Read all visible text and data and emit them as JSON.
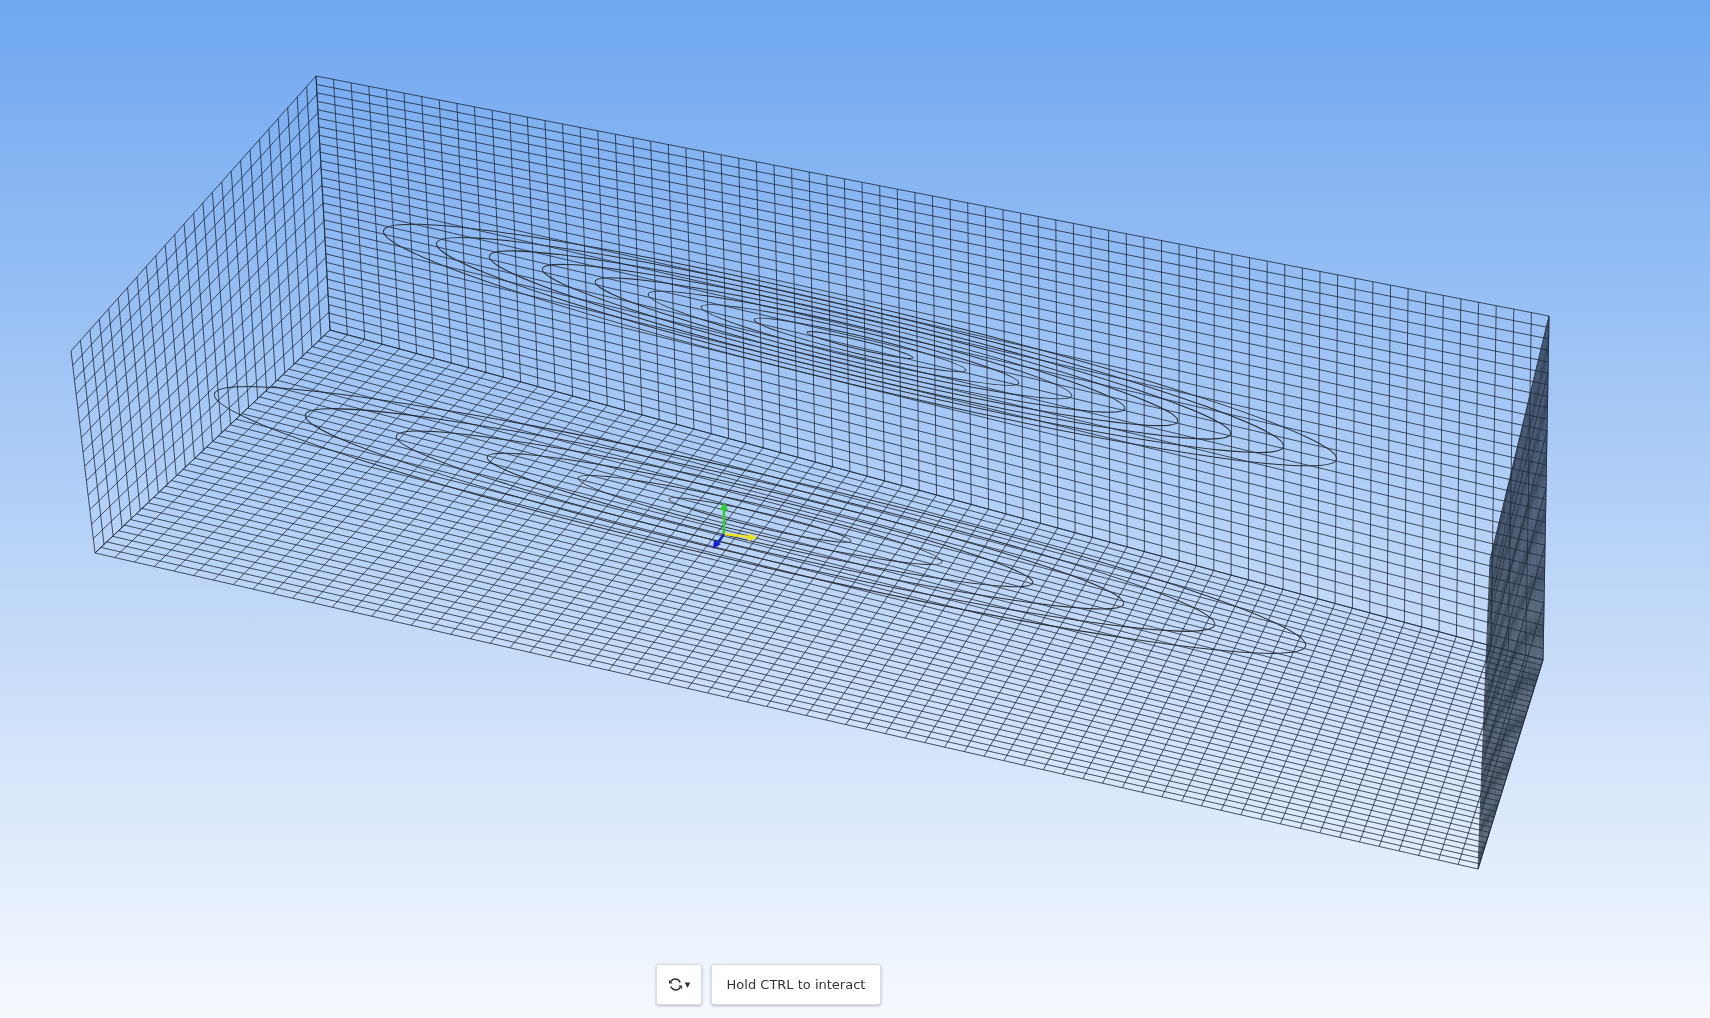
{
  "toolbar": {
    "view_menu_button": {
      "symbol": "▾"
    },
    "hint_button": {
      "label": "Hold CTRL to interact"
    }
  }
}
